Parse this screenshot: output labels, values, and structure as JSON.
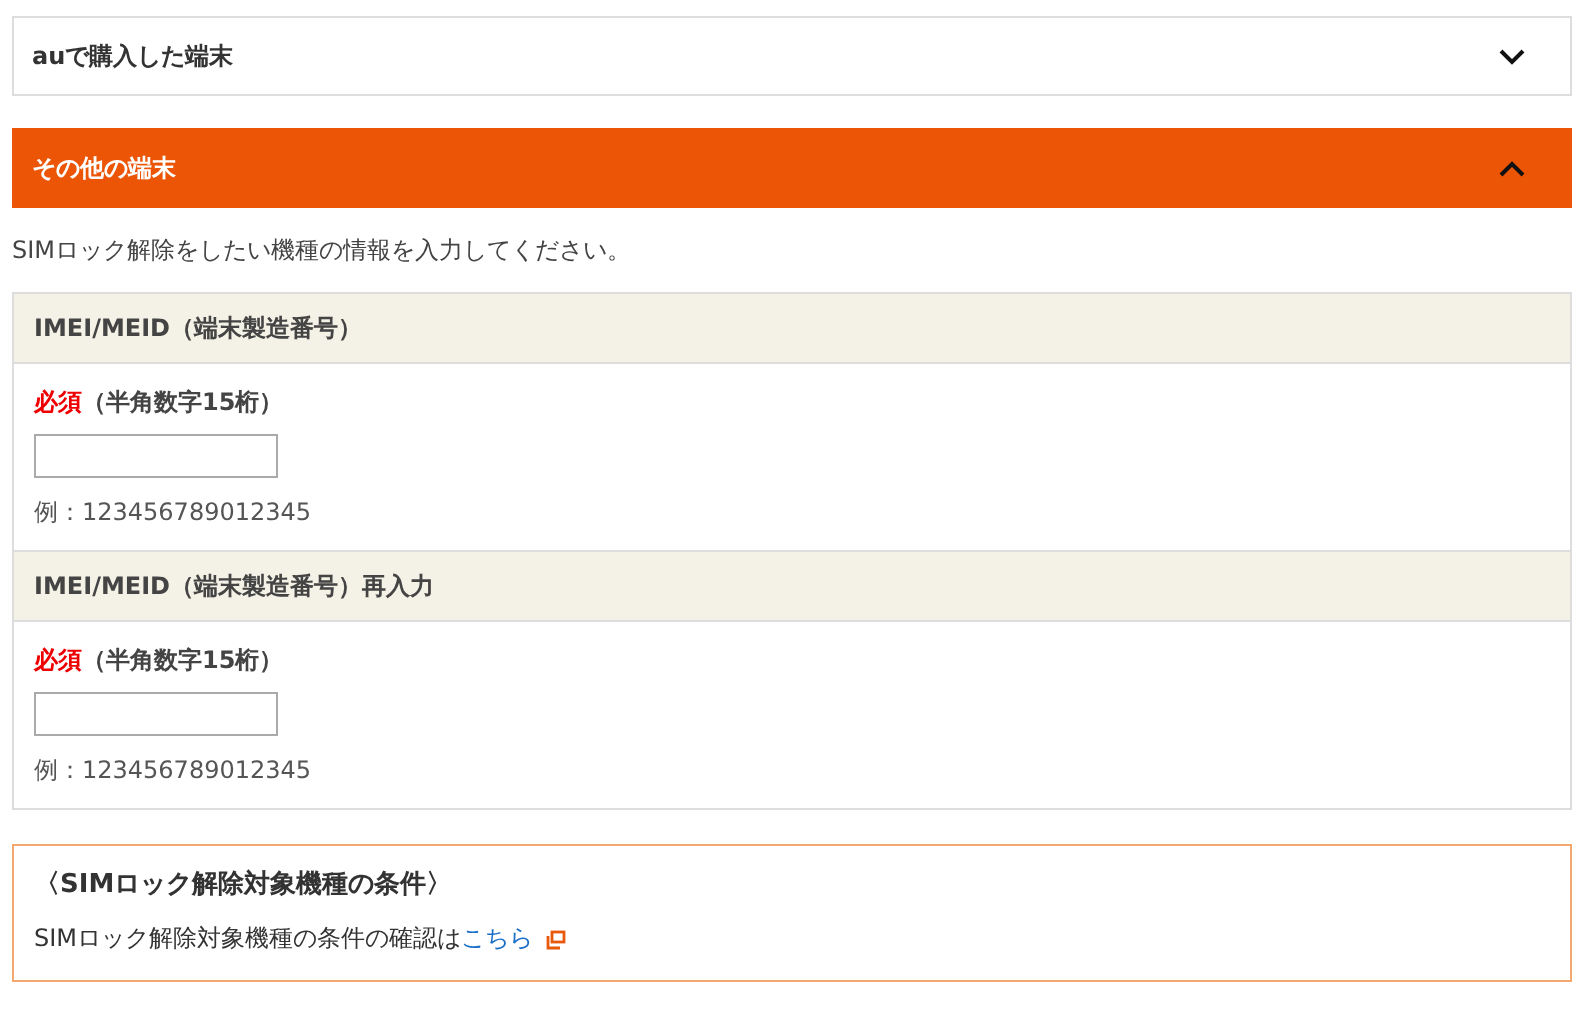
{
  "accordions": [
    {
      "title": "auで購入した端末",
      "expanded": false
    },
    {
      "title": "その他の端末",
      "expanded": true
    }
  ],
  "intro": "SIMロック解除をしたい機種の情報を入力してください。",
  "fields": [
    {
      "label": "IMEI/MEID（端末製造番号）",
      "required": "必須",
      "hint": "（半角数字15桁）",
      "example": "例：123456789012345"
    },
    {
      "label": "IMEI/MEID（端末製造番号）再入力",
      "required": "必須",
      "hint": "（半角数字15桁）",
      "example": "例：123456789012345"
    }
  ],
  "conditions": {
    "title": "〈SIMロック解除対象機種の条件〉",
    "text": "SIMロック解除対象機種の条件の確認は",
    "link": "こちら"
  }
}
